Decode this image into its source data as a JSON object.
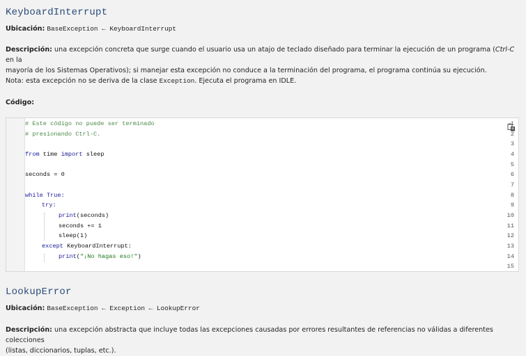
{
  "sections": [
    {
      "title": "KeyboardInterrupt",
      "location_label": "Ubicación:",
      "location_value": "BaseException ← KeyboardInterrupt",
      "description_label": "Descripción:",
      "description_pre": " una excepción concreta que surge cuando el usuario usa un atajo de teclado diseñado para terminar la ejecución de un programa (",
      "description_em": "Ctrl-C",
      "description_post": " en la",
      "description_line2": "mayoría de los Sistemas Operativos); si manejar esta excepción no conduce a la terminación del programa, el programa continúa su ejecución.",
      "note_pre": "Nota: esta excepción no se deriva de la clase ",
      "note_code": "Exception",
      "note_post": ". Ejecuta el programa en IDLE.",
      "code_label": "Código:"
    },
    {
      "title": "LookupError",
      "location_label": "Ubicación:",
      "location_value": "BaseException ← Exception ← LookupError",
      "description_label": "Descripción:",
      "description_line1": " una excepción abstracta que incluye todas las excepciones causadas por errores resultantes de referencias no válidas a diferentes colecciones",
      "description_line2": "(listas, diccionarios, tuplas, etc.)."
    }
  ],
  "code": {
    "line_numbers": [
      "1",
      "2",
      "3",
      "4",
      "5",
      "6",
      "7",
      "8",
      "9",
      "10",
      "11",
      "12",
      "13",
      "14",
      "15"
    ],
    "lines": {
      "l1": "# Este código no puede ser terminado",
      "l2": "# presionando Ctrl-C.",
      "l4_kw1": "from",
      "l4_mid": " time ",
      "l4_kw2": "import",
      "l4_end": " sleep",
      "l6": "seconds = 0",
      "l8_kw": "while",
      "l8_kw2": " True:",
      "l9_kw": "try:",
      "l10_a": "print",
      "l10_b": "(seconds)",
      "l11": "seconds += 1",
      "l12": "sleep(1)",
      "l13_kw": "except",
      "l13_b": " KeyboardInterrupt:",
      "l14_a": "print",
      "l14_b": "(",
      "l14_str": "\"¡No hagas eso!\"",
      "l14_c": ")"
    },
    "copy_icon": "copy-icon"
  },
  "colors": {
    "heading": "#2a4a7a",
    "comment": "#4a8a4a",
    "keyword": "#1a1a9a",
    "string": "#1a7a1a"
  }
}
